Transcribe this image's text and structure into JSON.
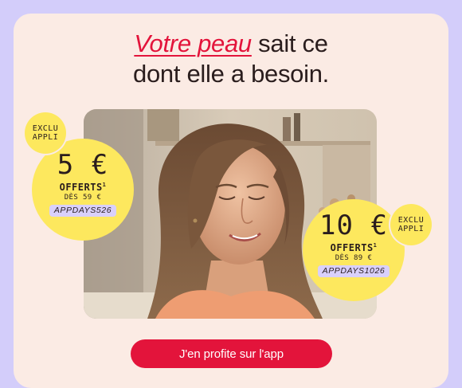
{
  "headline": {
    "accent": "Votre peau",
    "line1_rest": " sait ce",
    "line2": "dont elle a besoin."
  },
  "photo": {
    "alt": "Femme souriante les yeux fermés"
  },
  "offer_left": {
    "tag": [
      "EXCLU",
      "APPLI"
    ],
    "amount": "5 €",
    "label": "OFFERTS",
    "footnote": "1",
    "minimum": "DÈS 59 €",
    "code": "APPDAYS526"
  },
  "offer_right": {
    "tag": [
      "EXCLU",
      "APPLI"
    ],
    "amount": "10 €",
    "label": "OFFERTS",
    "footnote": "1",
    "minimum": "DÈS 89 €",
    "code": "APPDAYS1026"
  },
  "cta": {
    "label": "J'en profite sur l'app"
  },
  "colors": {
    "background": "#d3cdfa",
    "card": "#fbebe4",
    "accent": "#e3143b",
    "badge": "#fde85e",
    "code_bg": "#d9d0fb"
  }
}
